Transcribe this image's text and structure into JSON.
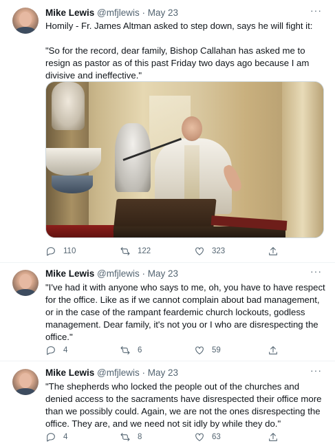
{
  "tweets": [
    {
      "name": "Mike Lewis",
      "handle": "@mfjlewis",
      "separator": "·",
      "date": "May 23",
      "more": "···",
      "text": "Homily - Fr. James Altman asked to step down, says he will fight it:\n\n\"So for the record, dear family, Bishop Callahan has asked me to resign as pastor as of this past Friday two days ago because I am divisive and ineffective.\"",
      "reply_count": "110",
      "retweet_count": "122",
      "like_count": "323"
    },
    {
      "name": "Mike Lewis",
      "handle": "@mfjlewis",
      "separator": "·",
      "date": "May 23",
      "more": "···",
      "text": "\"I've had it with anyone who says to me, oh, you have to have respect for the office. Like as if we cannot complain about bad management, or in the case of the rampant feardemic church lockouts, godless management. Dear family, it's not you or I who are disrespecting the office.\"",
      "reply_count": "4",
      "retweet_count": "6",
      "like_count": "59"
    },
    {
      "name": "Mike Lewis",
      "handle": "@mfjlewis",
      "separator": "·",
      "date": "May 23",
      "more": "···",
      "text": "\"The shepherds who locked the people out of the churches and denied access to the sacraments have disrespected their office more than we possibly could. Again, we are not the ones disrespecting the office. They are, and we need not sit idly by while they do.\"",
      "reply_count": "4",
      "retweet_count": "8",
      "like_count": "63"
    }
  ],
  "icons": {
    "reply": "reply-icon",
    "retweet": "retweet-icon",
    "like": "heart-icon",
    "share": "share-icon",
    "more": "more-icon"
  },
  "colors": {
    "text": "#0f1419",
    "secondary": "#536471",
    "divider": "#eff3f4"
  }
}
